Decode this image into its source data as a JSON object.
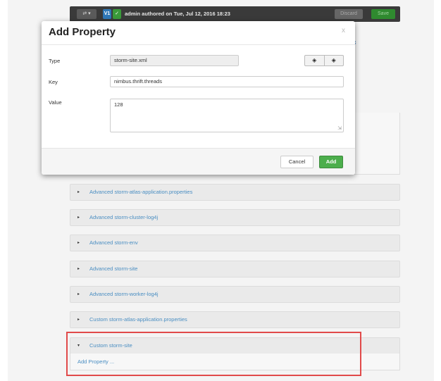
{
  "toolbar": {
    "compare_label": "⇄ ▾",
    "version_label": "V1",
    "check_label": "✓",
    "author_text": "admin authored on Tue, Jul 12, 2016 18:23",
    "discard_label": "Discard",
    "save_label": "Save"
  },
  "modal": {
    "title": "Add Property",
    "close_label": "x",
    "type_label": "Type",
    "type_value": "storm-site.xml",
    "key_label": "Key",
    "key_value": "nimbus.thrift.threads",
    "value_label": "Value",
    "value_value": "128",
    "cancel_label": "Cancel",
    "add_label": "Add"
  },
  "side_links": {
    "override_glyph": "o",
    "refresh_glyph": "c"
  },
  "sections": [
    {
      "label": "Advanced storm-atlas-application.properties",
      "arrow": "▸"
    },
    {
      "label": "Advanced storm-cluster-log4j",
      "arrow": "▸"
    },
    {
      "label": "Advanced storm-env",
      "arrow": "▸"
    },
    {
      "label": "Advanced storm-site",
      "arrow": "▸"
    },
    {
      "label": "Advanced storm-worker-log4j",
      "arrow": "▸"
    },
    {
      "label": "Custom storm-atlas-application.properties",
      "arrow": "▸"
    },
    {
      "label": "Custom storm-site",
      "arrow": "▾"
    }
  ],
  "custom_site": {
    "add_property_link": "Add Property ..."
  },
  "colors": {
    "link": "#4a8ec2",
    "success": "#4cae4c",
    "highlight": "#e14a4a"
  }
}
